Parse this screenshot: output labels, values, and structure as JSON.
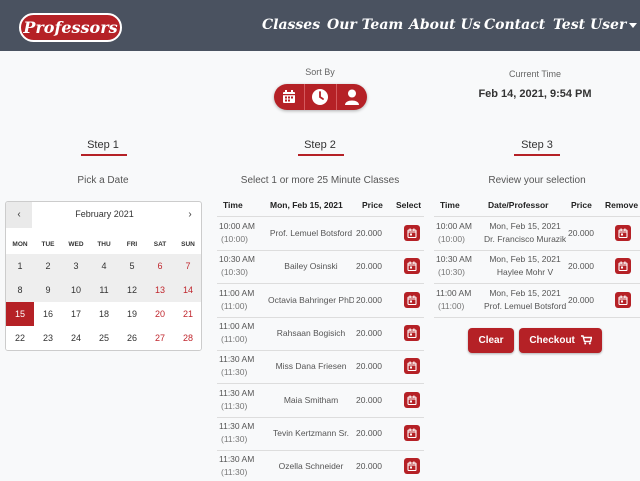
{
  "nav": {
    "brand": "Professors",
    "links": [
      "Classes",
      "Our Team",
      "About Us",
      "Contact"
    ],
    "user": "Test User"
  },
  "sort": {
    "label": "Sort By",
    "buttons": [
      "calendar-icon",
      "clock-icon",
      "user-icon"
    ]
  },
  "current_time": {
    "label": "Current Time",
    "value": "Feb 14, 2021, 9:54 PM"
  },
  "steps": [
    {
      "title": "Step 1",
      "subtitle": "Pick a Date"
    },
    {
      "title": "Step 2",
      "subtitle": "Select 1 or more 25 Minute Classes"
    },
    {
      "title": "Step 3",
      "subtitle": "Review your selection"
    }
  ],
  "calendar": {
    "prev": "‹",
    "next": "›",
    "month": "February 2021",
    "weekdays": [
      "MON",
      "TUE",
      "WED",
      "THU",
      "FRI",
      "SAT",
      "SUN"
    ],
    "weeks": [
      [
        "1",
        "2",
        "3",
        "4",
        "5",
        "6",
        "7"
      ],
      [
        "8",
        "9",
        "10",
        "11",
        "12",
        "13",
        "14"
      ],
      [
        "15",
        "16",
        "17",
        "18",
        "19",
        "20",
        "21"
      ],
      [
        "22",
        "23",
        "24",
        "25",
        "26",
        "27",
        "28"
      ]
    ],
    "selected": "15",
    "colors": {
      "accent": "#b52126",
      "weekend": "#c0262d"
    }
  },
  "classes": {
    "headers": [
      "Time",
      "Mon, Feb 15, 2021",
      "Price",
      "Select"
    ],
    "rows": [
      {
        "time": "10:00 AM",
        "time_sub": "(10:00)",
        "professor": "Prof. Lemuel Botsford",
        "price": "20.000"
      },
      {
        "time": "10:30 AM",
        "time_sub": "(10:30)",
        "professor": "Bailey Osinski",
        "price": "20.000"
      },
      {
        "time": "11:00 AM",
        "time_sub": "(11:00)",
        "professor": "Octavia Bahringer PhD",
        "price": "20.000"
      },
      {
        "time": "11:00 AM",
        "time_sub": "(11:00)",
        "professor": "Rahsaan Bogisich",
        "price": "20.000"
      },
      {
        "time": "11:30 AM",
        "time_sub": "(11:30)",
        "professor": "Miss Dana Friesen",
        "price": "20.000"
      },
      {
        "time": "11:30 AM",
        "time_sub": "(11:30)",
        "professor": "Maia Smitham",
        "price": "20.000"
      },
      {
        "time": "11:30 AM",
        "time_sub": "(11:30)",
        "professor": "Tevin Kertzmann Sr.",
        "price": "20.000"
      },
      {
        "time": "11:30 AM",
        "time_sub": "(11:30)",
        "professor": "Ozella Schneider",
        "price": "20.000"
      }
    ]
  },
  "selection": {
    "headers": [
      "Time",
      "Date/Professor",
      "Price",
      "Remove"
    ],
    "rows": [
      {
        "time": "10:00 AM",
        "time_sub": "(10:00)",
        "date": "Mon, Feb 15, 2021",
        "professor": "Dr. Francisco Murazik",
        "price": "20.000"
      },
      {
        "time": "10:30 AM",
        "time_sub": "(10:30)",
        "date": "Mon, Feb 15, 2021",
        "professor": "Haylee Mohr V",
        "price": "20.000"
      },
      {
        "time": "11:00 AM",
        "time_sub": "(11:00)",
        "date": "Mon, Feb 15, 2021",
        "professor": "Prof. Lemuel Botsford",
        "price": "20.000"
      }
    ],
    "clear": "Clear",
    "checkout": "Checkout"
  }
}
